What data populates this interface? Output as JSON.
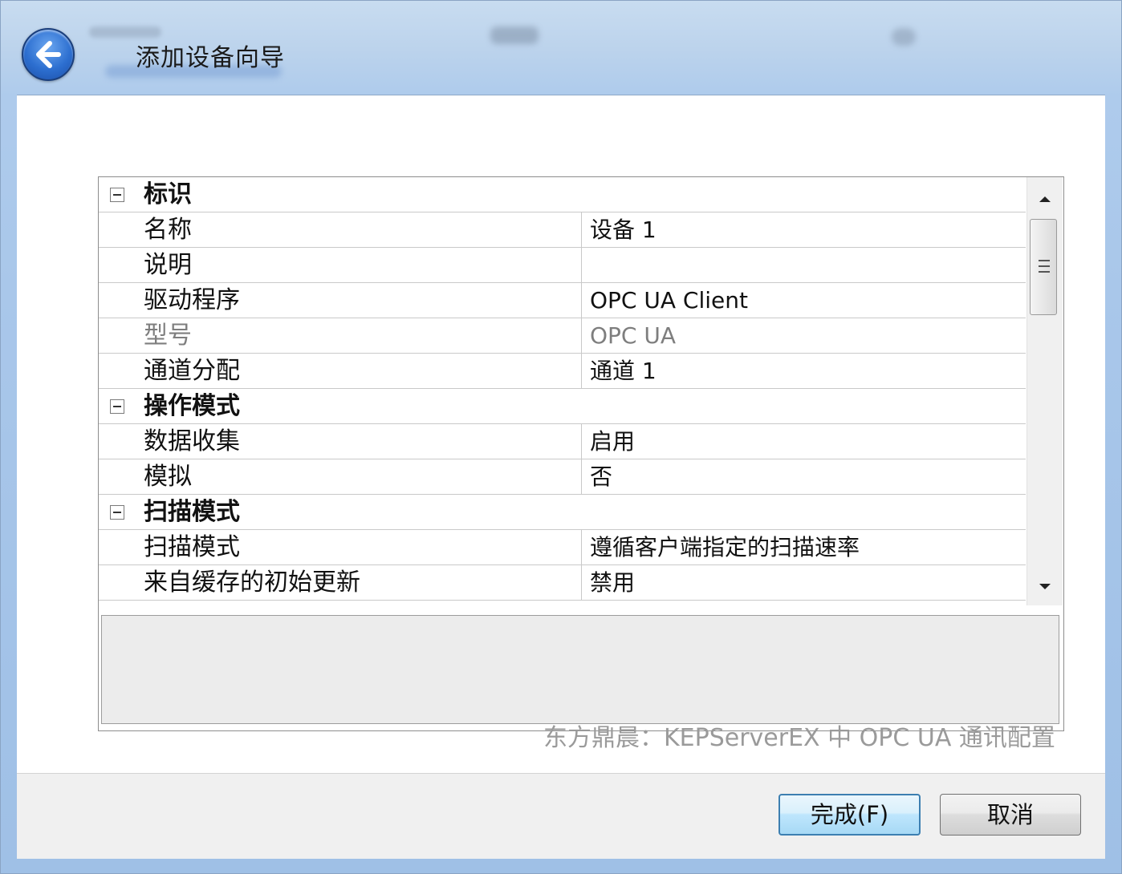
{
  "window": {
    "title": "添加设备向导"
  },
  "properties": [
    {
      "type": "category",
      "label": "标识"
    },
    {
      "type": "property",
      "name": "名称",
      "value": "设备 1"
    },
    {
      "type": "property",
      "name": "说明",
      "value": ""
    },
    {
      "type": "property",
      "name": "驱动程序",
      "value": "OPC UA Client"
    },
    {
      "type": "property",
      "name": "型号",
      "value": "OPC UA",
      "disabled": true
    },
    {
      "type": "property",
      "name": "通道分配",
      "value": "通道 1"
    },
    {
      "type": "category",
      "label": "操作模式"
    },
    {
      "type": "property",
      "name": "数据收集",
      "value": "启用"
    },
    {
      "type": "property",
      "name": "模拟",
      "value": "否"
    },
    {
      "type": "category",
      "label": "扫描模式"
    },
    {
      "type": "property",
      "name": "扫描模式",
      "value": "遵循客户端指定的扫描速率"
    },
    {
      "type": "property",
      "name": "来自缓存的初始更新",
      "value": "禁用"
    }
  ],
  "watermark": "东方鼎晨：KEPServerEX 中 OPC UA 通讯配置",
  "buttons": {
    "finish_label": "完成(F)",
    "cancel_label": "取消"
  },
  "colors": {
    "title_bar": "#aecbec",
    "primary_button_border": "#3c7fb1",
    "disabled_text": "#7e7e7e"
  }
}
